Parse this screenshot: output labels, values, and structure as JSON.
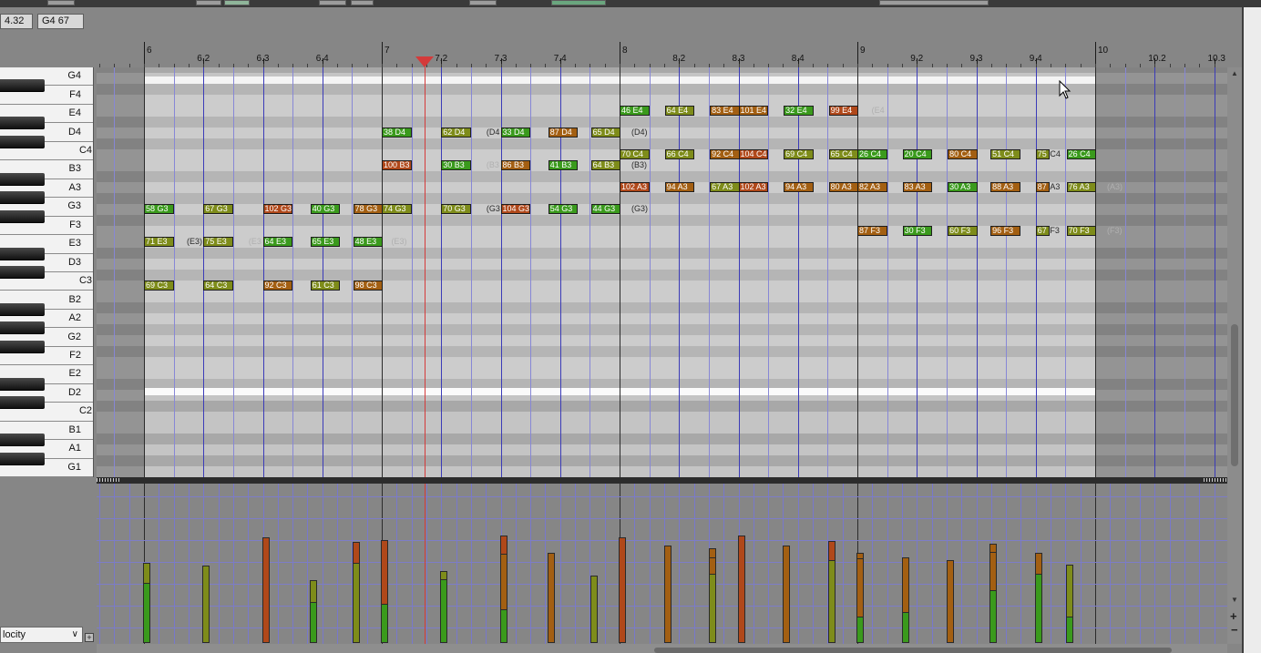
{
  "header": {
    "position_value": "4.32",
    "note_value": "G4  67"
  },
  "ruler": {
    "labels": [
      {
        "label": "6",
        "beat": 6.0,
        "major": true
      },
      {
        "label": "6.2",
        "beat": 6.25,
        "major": false
      },
      {
        "label": "6.3",
        "beat": 6.5,
        "major": false
      },
      {
        "label": "6.4",
        "beat": 6.75,
        "major": false
      },
      {
        "label": "7",
        "beat": 7.0,
        "major": true
      },
      {
        "label": "7.2",
        "beat": 7.25,
        "major": false
      },
      {
        "label": "7.3",
        "beat": 7.5,
        "major": false
      },
      {
        "label": "7.4",
        "beat": 7.75,
        "major": false
      },
      {
        "label": "8",
        "beat": 8.0,
        "major": true
      },
      {
        "label": "8.2",
        "beat": 8.25,
        "major": false
      },
      {
        "label": "8.3",
        "beat": 8.5,
        "major": false
      },
      {
        "label": "8.4",
        "beat": 8.75,
        "major": false
      },
      {
        "label": "9",
        "beat": 9.0,
        "major": true
      },
      {
        "label": "9.2",
        "beat": 9.25,
        "major": false
      },
      {
        "label": "9.3",
        "beat": 9.5,
        "major": false
      },
      {
        "label": "9.4",
        "beat": 9.75,
        "major": false
      },
      {
        "label": "10",
        "beat": 10.0,
        "major": true
      },
      {
        "label": "10.2",
        "beat": 10.25,
        "major": false
      },
      {
        "label": "10.3",
        "beat": 10.5,
        "major": false
      }
    ],
    "playhead_beat": 7.18
  },
  "keyboard": {
    "keys": [
      "G4",
      "F4",
      "E4",
      "D4",
      "C4",
      "B3",
      "A3",
      "G3",
      "F3",
      "E3",
      "D3",
      "C3",
      "B2",
      "A2",
      "G2",
      "F2",
      "E2",
      "D2",
      "C2",
      "B1",
      "A1",
      "G1"
    ]
  },
  "colors": {
    "green": "#3a9a1c",
    "olive": "#7e8c1a",
    "brown": "#a35f12",
    "rust": "#b0481a",
    "playhead": "#d43a3a"
  },
  "notes": [
    {
      "text": "58 G3",
      "pitch": "G3",
      "start": 6.0,
      "len": 0.125,
      "color": "green"
    },
    {
      "text": "67 G3",
      "pitch": "G3",
      "start": 6.25,
      "len": 0.125,
      "color": "olive"
    },
    {
      "text": "102 G3",
      "pitch": "G3",
      "start": 6.5,
      "len": 0.125,
      "color": "rust"
    },
    {
      "text": "40 G3",
      "pitch": "G3",
      "start": 6.7,
      "len": 0.125,
      "color": "green"
    },
    {
      "text": "78 G3",
      "pitch": "G3",
      "start": 6.88,
      "len": 0.125,
      "color": "brown"
    },
    {
      "text": "74 G3",
      "pitch": "G3",
      "start": 7.0,
      "len": 0.125,
      "color": "olive"
    },
    {
      "text": "70 G3",
      "pitch": "G3",
      "start": 7.25,
      "len": 0.125,
      "color": "olive"
    },
    {
      "text": "104 G3",
      "pitch": "G3",
      "start": 7.5,
      "len": 0.125,
      "color": "rust"
    },
    {
      "text": "54 G3",
      "pitch": "G3",
      "start": 7.7,
      "len": 0.125,
      "color": "green"
    },
    {
      "text": "44 G3",
      "pitch": "G3",
      "start": 7.88,
      "len": 0.125,
      "color": "green"
    },
    {
      "text": "71 E3",
      "pitch": "E3",
      "start": 6.0,
      "len": 0.125,
      "color": "olive"
    },
    {
      "text": "75 E3",
      "pitch": "E3",
      "start": 6.25,
      "len": 0.125,
      "color": "olive"
    },
    {
      "text": "64 E3",
      "pitch": "E3",
      "start": 6.5,
      "len": 0.125,
      "color": "green"
    },
    {
      "text": "65 E3",
      "pitch": "E3",
      "start": 6.7,
      "len": 0.125,
      "color": "green"
    },
    {
      "text": "48 E3",
      "pitch": "E3",
      "start": 6.88,
      "len": 0.125,
      "color": "green"
    },
    {
      "text": "69 C3",
      "pitch": "C3",
      "start": 6.0,
      "len": 0.125,
      "color": "olive"
    },
    {
      "text": "64 C3",
      "pitch": "C3",
      "start": 6.25,
      "len": 0.125,
      "color": "olive"
    },
    {
      "text": "92 C3",
      "pitch": "C3",
      "start": 6.5,
      "len": 0.125,
      "color": "brown"
    },
    {
      "text": "61 C3",
      "pitch": "C3",
      "start": 6.7,
      "len": 0.125,
      "color": "olive"
    },
    {
      "text": "98 C3",
      "pitch": "C3",
      "start": 6.88,
      "len": 0.125,
      "color": "brown"
    },
    {
      "text": "38 D4",
      "pitch": "D4",
      "start": 7.0,
      "len": 0.125,
      "color": "green"
    },
    {
      "text": "62 D4",
      "pitch": "D4",
      "start": 7.25,
      "len": 0.125,
      "color": "olive"
    },
    {
      "text": "33 D4",
      "pitch": "D4",
      "start": 7.5,
      "len": 0.125,
      "color": "green"
    },
    {
      "text": "87 D4",
      "pitch": "D4",
      "start": 7.7,
      "len": 0.125,
      "color": "brown"
    },
    {
      "text": "65 D4",
      "pitch": "D4",
      "start": 7.88,
      "len": 0.125,
      "color": "olive"
    },
    {
      "text": "100 B3",
      "pitch": "B3",
      "start": 7.0,
      "len": 0.125,
      "color": "rust"
    },
    {
      "text": "30 B3",
      "pitch": "B3",
      "start": 7.25,
      "len": 0.125,
      "color": "green"
    },
    {
      "text": "86 B3",
      "pitch": "B3",
      "start": 7.5,
      "len": 0.125,
      "color": "brown"
    },
    {
      "text": "41 B3",
      "pitch": "B3",
      "start": 7.7,
      "len": 0.125,
      "color": "green"
    },
    {
      "text": "64 B3",
      "pitch": "B3",
      "start": 7.88,
      "len": 0.125,
      "color": "olive"
    },
    {
      "text": "46 E4",
      "pitch": "E4",
      "start": 8.0,
      "len": 0.125,
      "color": "green"
    },
    {
      "text": "64 E4",
      "pitch": "E4",
      "start": 8.19,
      "len": 0.125,
      "color": "olive"
    },
    {
      "text": "83 E4",
      "pitch": "E4",
      "start": 8.38,
      "len": 0.125,
      "color": "brown"
    },
    {
      "text": "101 E4",
      "pitch": "E4",
      "start": 8.5,
      "len": 0.125,
      "color": "brown"
    },
    {
      "text": "32 E4",
      "pitch": "E4",
      "start": 8.69,
      "len": 0.125,
      "color": "green"
    },
    {
      "text": "99 E4",
      "pitch": "E4",
      "start": 8.88,
      "len": 0.125,
      "color": "rust"
    },
    {
      "text": "70 C4",
      "pitch": "C4",
      "start": 8.0,
      "len": 0.125,
      "color": "olive"
    },
    {
      "text": "66 C4",
      "pitch": "C4",
      "start": 8.19,
      "len": 0.125,
      "color": "olive"
    },
    {
      "text": "92 C4",
      "pitch": "C4",
      "start": 8.38,
      "len": 0.125,
      "color": "brown"
    },
    {
      "text": "104 C4",
      "pitch": "C4",
      "start": 8.5,
      "len": 0.125,
      "color": "rust"
    },
    {
      "text": "69 C4",
      "pitch": "C4",
      "start": 8.69,
      "len": 0.125,
      "color": "olive"
    },
    {
      "text": "65 C4",
      "pitch": "C4",
      "start": 8.88,
      "len": 0.125,
      "color": "olive"
    },
    {
      "text": "26 C4",
      "pitch": "C4",
      "start": 9.0,
      "len": 0.125,
      "color": "green"
    },
    {
      "text": "20 C4",
      "pitch": "C4",
      "start": 9.19,
      "len": 0.125,
      "color": "green"
    },
    {
      "text": "80 C4",
      "pitch": "C4",
      "start": 9.38,
      "len": 0.125,
      "color": "brown"
    },
    {
      "text": "51 C4",
      "pitch": "C4",
      "start": 9.56,
      "len": 0.125,
      "color": "olive"
    },
    {
      "text": "75 C4",
      "pitch": "C4",
      "start": 9.75,
      "len": 0.06,
      "color": "olive"
    },
    {
      "text": "26 C4",
      "pitch": "C4",
      "start": 9.88,
      "len": 0.125,
      "color": "green"
    },
    {
      "text": "102 A3",
      "pitch": "A3",
      "start": 8.0,
      "len": 0.125,
      "color": "rust"
    },
    {
      "text": "94 A3",
      "pitch": "A3",
      "start": 8.19,
      "len": 0.125,
      "color": "brown"
    },
    {
      "text": "67 A3",
      "pitch": "A3",
      "start": 8.38,
      "len": 0.125,
      "color": "olive"
    },
    {
      "text": "102 A3",
      "pitch": "A3",
      "start": 8.5,
      "len": 0.125,
      "color": "rust"
    },
    {
      "text": "94 A3",
      "pitch": "A3",
      "start": 8.69,
      "len": 0.125,
      "color": "brown"
    },
    {
      "text": "80 A3",
      "pitch": "A3",
      "start": 8.88,
      "len": 0.125,
      "color": "brown"
    },
    {
      "text": "82 A3",
      "pitch": "A3",
      "start": 9.0,
      "len": 0.125,
      "color": "brown"
    },
    {
      "text": "83 A3",
      "pitch": "A3",
      "start": 9.19,
      "len": 0.125,
      "color": "brown"
    },
    {
      "text": "30 A3",
      "pitch": "A3",
      "start": 9.38,
      "len": 0.125,
      "color": "green"
    },
    {
      "text": "88 A3",
      "pitch": "A3",
      "start": 9.56,
      "len": 0.125,
      "color": "brown"
    },
    {
      "text": "87 A3",
      "pitch": "A3",
      "start": 9.75,
      "len": 0.06,
      "color": "brown"
    },
    {
      "text": "76 A3",
      "pitch": "A3",
      "start": 9.88,
      "len": 0.125,
      "color": "olive"
    },
    {
      "text": "87 F3",
      "pitch": "F3",
      "start": 9.0,
      "len": 0.125,
      "color": "brown"
    },
    {
      "text": "30 F3",
      "pitch": "F3",
      "start": 9.19,
      "len": 0.125,
      "color": "green"
    },
    {
      "text": "60 F3",
      "pitch": "F3",
      "start": 9.38,
      "len": 0.125,
      "color": "olive"
    },
    {
      "text": "96 F3",
      "pitch": "F3",
      "start": 9.56,
      "len": 0.125,
      "color": "brown"
    },
    {
      "text": "67 F3",
      "pitch": "F3",
      "start": 9.75,
      "len": 0.06,
      "color": "olive"
    },
    {
      "text": "70 F3",
      "pitch": "F3",
      "start": 9.88,
      "len": 0.125,
      "color": "olive"
    }
  ],
  "ghost_labels": [
    {
      "text": "(E3)",
      "pitch": "E3",
      "start": 6.18,
      "faint": false
    },
    {
      "text": "(E3",
      "pitch": "E3",
      "start": 6.44,
      "faint": true
    },
    {
      "text": "(E3)",
      "pitch": "E3",
      "start": 7.04,
      "faint": true
    },
    {
      "text": "(D4",
      "pitch": "D4",
      "start": 7.44,
      "faint": false
    },
    {
      "text": "(D4)",
      "pitch": "D4",
      "start": 8.05,
      "faint": false
    },
    {
      "text": "(B3)",
      "pitch": "B3",
      "start": 8.05,
      "faint": false
    },
    {
      "text": "(B3",
      "pitch": "B3",
      "start": 7.44,
      "faint": true
    },
    {
      "text": "(G3",
      "pitch": "G3",
      "start": 7.44,
      "faint": false
    },
    {
      "text": "(G3)",
      "pitch": "G3",
      "start": 8.05,
      "faint": false
    },
    {
      "text": "C4",
      "pitch": "C4",
      "start": 9.81,
      "faint": false
    },
    {
      "text": "A3",
      "pitch": "A3",
      "start": 9.81,
      "faint": false
    },
    {
      "text": "F3",
      "pitch": "F3",
      "start": 9.81,
      "faint": false
    },
    {
      "text": "(A3)",
      "pitch": "A3",
      "start": 10.05,
      "faint": true
    },
    {
      "text": "(F3)",
      "pitch": "F3",
      "start": 10.05,
      "faint": true
    },
    {
      "text": "(E4",
      "pitch": "E4",
      "start": 9.06,
      "faint": true
    }
  ],
  "velocity_lane": {
    "selector_label": "locity",
    "bars": [
      {
        "beat": 6.0,
        "levels": [
          [
            "green",
            58
          ],
          [
            "olive",
            78
          ]
        ]
      },
      {
        "beat": 6.25,
        "levels": [
          [
            "olive",
            75
          ]
        ]
      },
      {
        "beat": 6.5,
        "levels": [
          [
            "rust",
            102
          ]
        ]
      },
      {
        "beat": 6.7,
        "levels": [
          [
            "green",
            40
          ],
          [
            "olive",
            61
          ]
        ]
      },
      {
        "beat": 6.88,
        "levels": [
          [
            "olive",
            78
          ],
          [
            "rust",
            98
          ]
        ]
      },
      {
        "beat": 7.0,
        "levels": [
          [
            "green",
            38
          ],
          [
            "rust",
            100
          ]
        ]
      },
      {
        "beat": 7.25,
        "levels": [
          [
            "green",
            62
          ],
          [
            "olive",
            70
          ]
        ]
      },
      {
        "beat": 7.5,
        "levels": [
          [
            "green",
            33
          ],
          [
            "brown",
            86
          ],
          [
            "rust",
            104
          ]
        ]
      },
      {
        "beat": 7.7,
        "levels": [
          [
            "brown",
            87
          ]
        ]
      },
      {
        "beat": 7.88,
        "levels": [
          [
            "olive",
            65
          ]
        ]
      },
      {
        "beat": 8.0,
        "levels": [
          [
            "rust",
            102
          ]
        ]
      },
      {
        "beat": 8.19,
        "levels": [
          [
            "brown",
            94
          ]
        ]
      },
      {
        "beat": 8.38,
        "levels": [
          [
            "olive",
            67
          ],
          [
            "brown",
            83
          ],
          [
            "brown",
            92
          ]
        ]
      },
      {
        "beat": 8.5,
        "levels": [
          [
            "rust",
            104
          ]
        ]
      },
      {
        "beat": 8.69,
        "levels": [
          [
            "brown",
            94
          ]
        ]
      },
      {
        "beat": 8.88,
        "levels": [
          [
            "olive",
            80
          ],
          [
            "rust",
            99
          ]
        ]
      },
      {
        "beat": 9.0,
        "levels": [
          [
            "green",
            26
          ],
          [
            "brown",
            82
          ],
          [
            "brown",
            87
          ]
        ]
      },
      {
        "beat": 9.19,
        "levels": [
          [
            "green",
            30
          ],
          [
            "brown",
            83
          ]
        ]
      },
      {
        "beat": 9.38,
        "levels": [
          [
            "brown",
            80
          ]
        ]
      },
      {
        "beat": 9.56,
        "levels": [
          [
            "green",
            51
          ],
          [
            "brown",
            88
          ],
          [
            "brown",
            96
          ]
        ]
      },
      {
        "beat": 9.75,
        "levels": [
          [
            "green",
            67
          ],
          [
            "brown",
            87
          ]
        ]
      },
      {
        "beat": 9.88,
        "levels": [
          [
            "green",
            26
          ],
          [
            "olive",
            76
          ]
        ]
      }
    ]
  }
}
